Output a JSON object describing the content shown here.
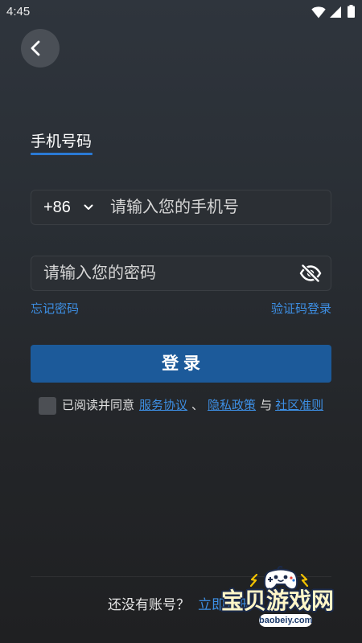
{
  "status_bar": {
    "time": "4:45",
    "icons": [
      "wifi-icon",
      "signal-icon",
      "battery-icon"
    ]
  },
  "header": {
    "back_icon": "chevron-left-icon"
  },
  "tabs": [
    {
      "label": "手机号码",
      "active": true
    }
  ],
  "phone_field": {
    "country_code": "+86",
    "country_icon": "chevron-down-icon",
    "placeholder": "请输入您的手机号",
    "value": ""
  },
  "password_field": {
    "placeholder": "请输入您的密码",
    "value": "",
    "toggle_icon": "eye-off-icon"
  },
  "links": {
    "forgot_password": "忘记密码",
    "sms_login": "验证码登录"
  },
  "login_button": {
    "label": "登 录"
  },
  "agreement": {
    "checked": false,
    "prefix": "已阅读并同意",
    "terms": "服务协议",
    "separator": "、",
    "privacy": "隐私政策",
    "conjunction": "与",
    "community": "社区准则"
  },
  "footer": {
    "prompt": "还没有账号？",
    "register": "立即注册"
  },
  "watermark": {
    "name": "宝贝游戏网",
    "domain": "baobeiy.com",
    "logo_icon": "game-controller-mascot-icon"
  },
  "colors": {
    "accent": "#2a7ad6",
    "link": "#3d8fe4",
    "primary_button": "#1c5a9a",
    "field_bg": "#2b2f34",
    "field_border": "#3a3e43"
  }
}
